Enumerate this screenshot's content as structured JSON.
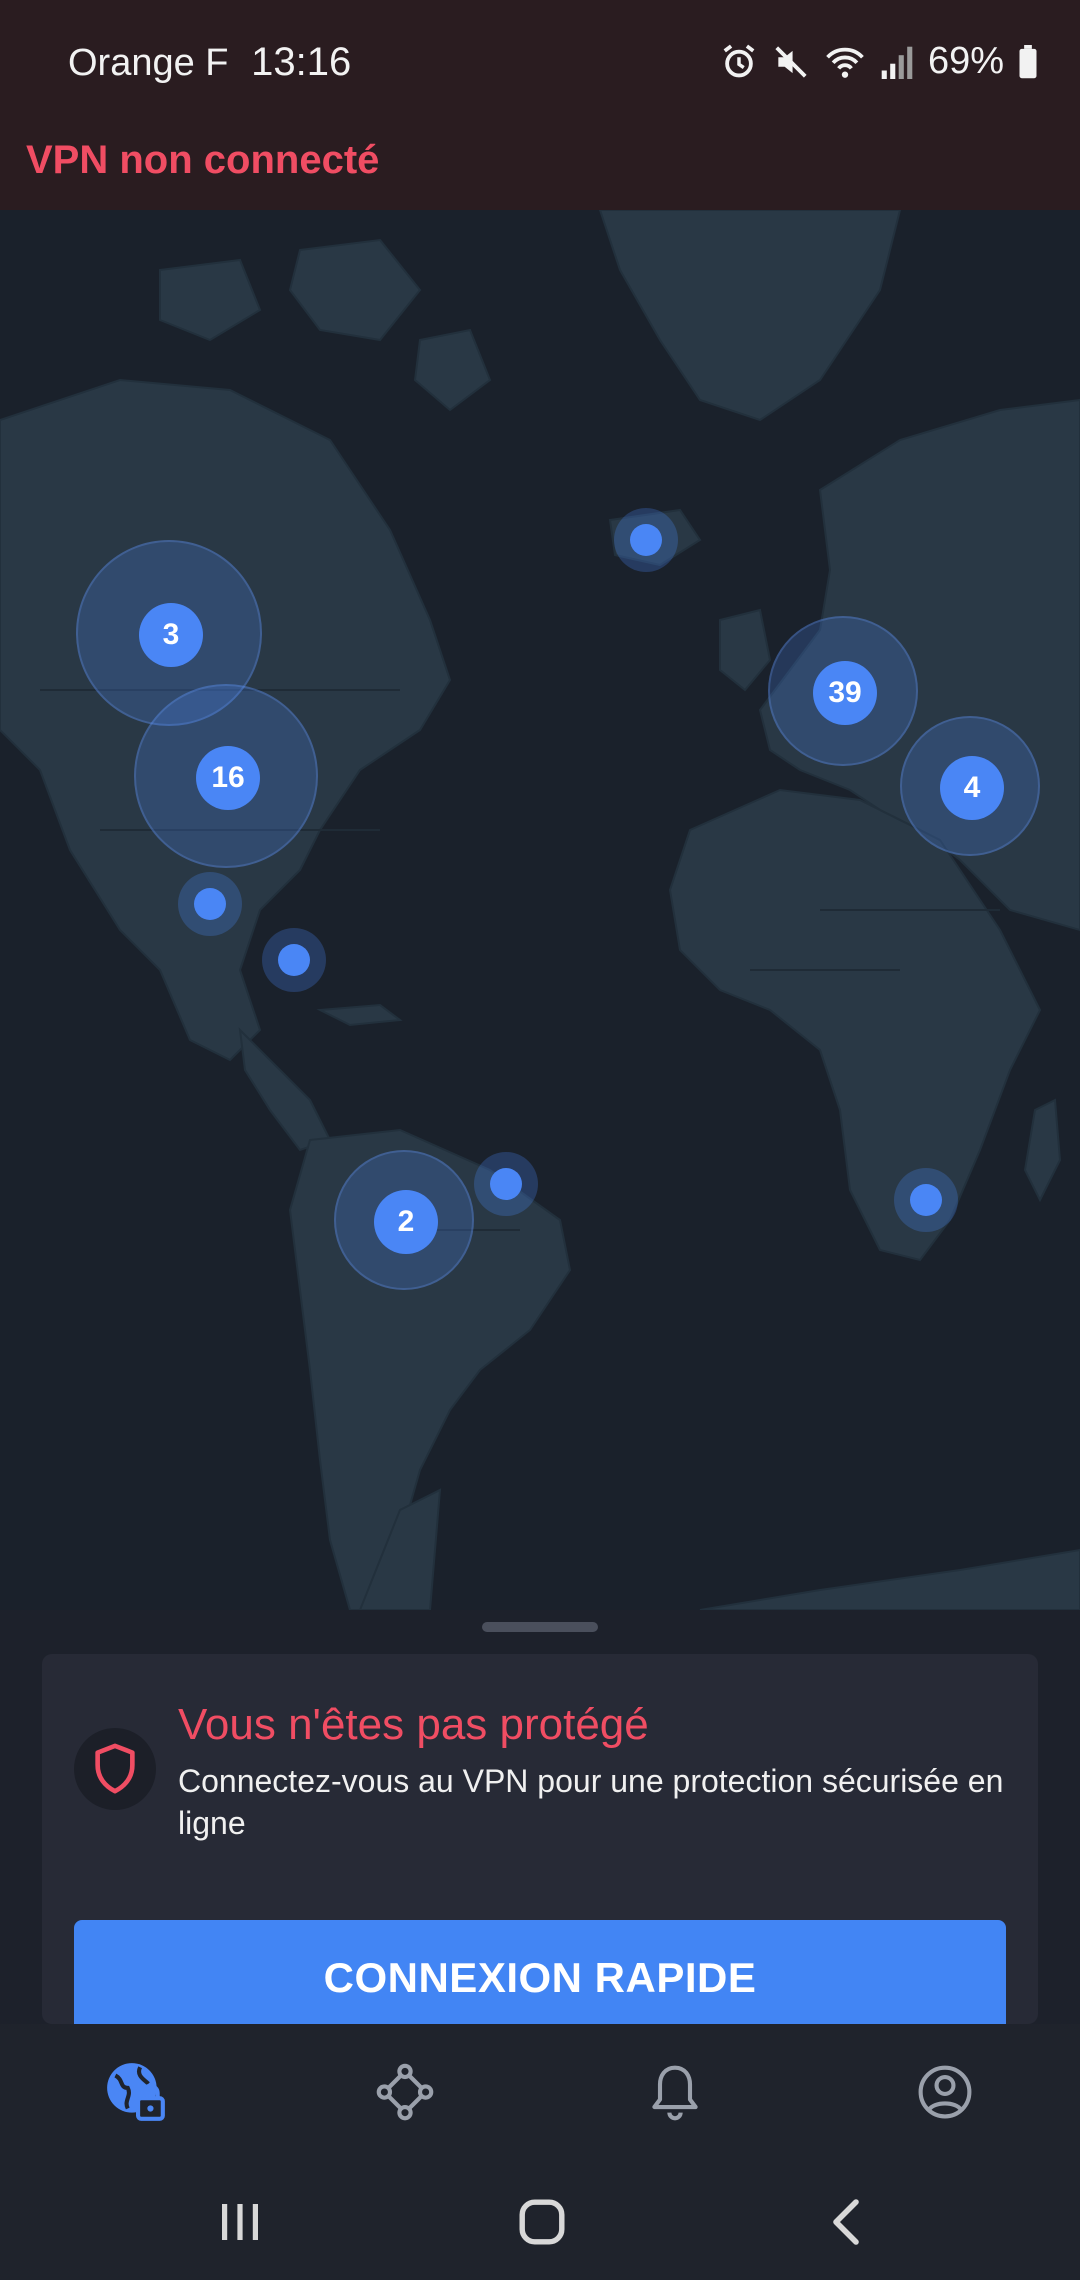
{
  "status_bar": {
    "carrier": "Orange F",
    "time": "13:16",
    "battery": "69%"
  },
  "banner": {
    "text": "VPN non connecté"
  },
  "map": {
    "clusters": [
      {
        "label": "3"
      },
      {
        "label": "16"
      },
      {
        "label": "39"
      },
      {
        "label": "4"
      },
      {
        "label": "2"
      }
    ]
  },
  "card": {
    "title": "Vous n'êtes pas protégé",
    "subtitle": "Connectez-vous au VPN pour une protection sécurisée en ligne",
    "button": "CONNEXION RAPIDE"
  },
  "nav": {
    "items": [
      "globe-lock-icon",
      "network-nodes-icon",
      "bell-icon",
      "account-icon"
    ],
    "active_index": 0
  },
  "colors": {
    "accent": "#4285f4",
    "alert": "#f04d63",
    "background": "#1a1f29"
  }
}
